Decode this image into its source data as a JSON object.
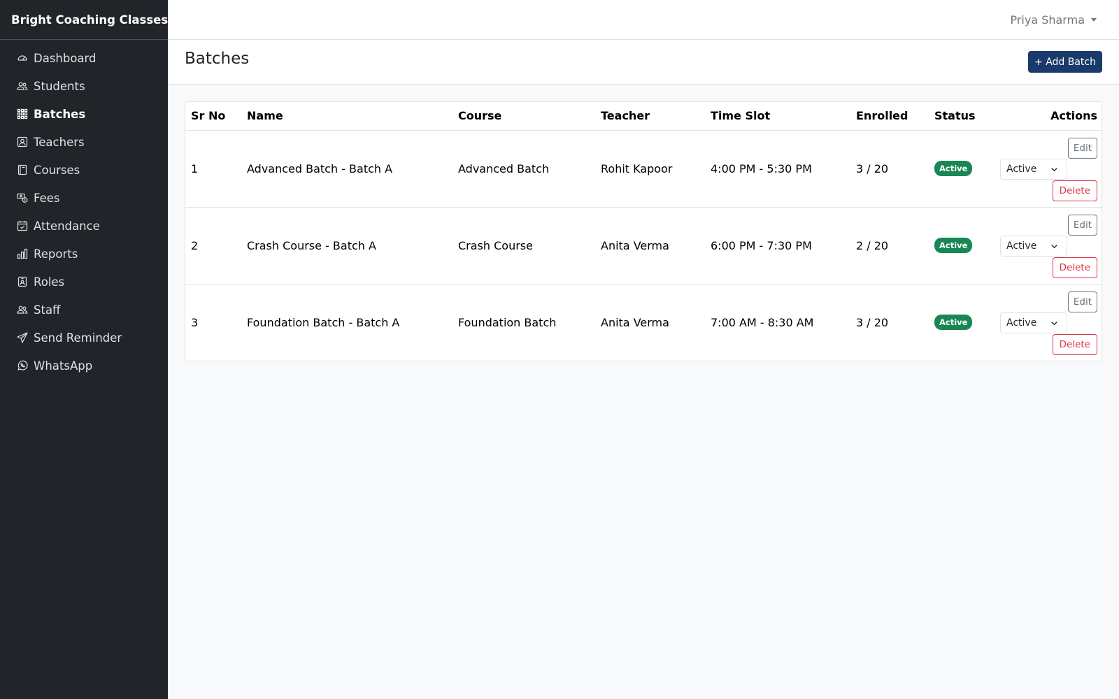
{
  "app": {
    "brand": "Bright Coaching Classes"
  },
  "sidebar": {
    "items": [
      {
        "label": "Dashboard",
        "icon": "speedometer-icon",
        "active": false
      },
      {
        "label": "Students",
        "icon": "people-icon",
        "active": false
      },
      {
        "label": "Batches",
        "icon": "grid-icon",
        "active": true
      },
      {
        "label": "Teachers",
        "icon": "person-badge-icon",
        "active": false
      },
      {
        "label": "Courses",
        "icon": "book-icon",
        "active": false
      },
      {
        "label": "Fees",
        "icon": "cash-coin-icon",
        "active": false
      },
      {
        "label": "Attendance",
        "icon": "calendar-check-icon",
        "active": false
      },
      {
        "label": "Reports",
        "icon": "bar-chart-icon",
        "active": false
      },
      {
        "label": "Roles",
        "icon": "id-badge-icon",
        "active": false
      },
      {
        "label": "Staff",
        "icon": "people-icon",
        "active": false
      },
      {
        "label": "Send Reminder",
        "icon": "send-icon",
        "active": false
      },
      {
        "label": "WhatsApp",
        "icon": "whatsapp-icon",
        "active": false
      }
    ]
  },
  "topbar": {
    "user_name": "Priya Sharma"
  },
  "page": {
    "title": "Batches",
    "add_button": "+ Add Batch"
  },
  "table": {
    "headers": {
      "sr": "Sr No",
      "name": "Name",
      "course": "Course",
      "teacher": "Teacher",
      "time": "Time Slot",
      "enrolled": "Enrolled",
      "status": "Status",
      "actions": "Actions"
    },
    "rows": [
      {
        "sr": "1",
        "name": "Advanced Batch - Batch A",
        "course": "Advanced Batch",
        "teacher": "Rohit Kapoor",
        "time": "4:00 PM - 5:30 PM",
        "enrolled": "3 / 20",
        "status": "Active",
        "select_value": "Active",
        "edit": "Edit",
        "delete": "Delete"
      },
      {
        "sr": "2",
        "name": "Crash Course - Batch A",
        "course": "Crash Course",
        "teacher": "Anita Verma",
        "time": "6:00 PM - 7:30 PM",
        "enrolled": "2 / 20",
        "status": "Active",
        "select_value": "Active",
        "edit": "Edit",
        "delete": "Delete"
      },
      {
        "sr": "3",
        "name": "Foundation Batch - Batch A",
        "course": "Foundation Batch",
        "teacher": "Anita Verma",
        "time": "7:00 AM - 8:30 AM",
        "enrolled": "3 / 20",
        "status": "Active",
        "select_value": "Active",
        "edit": "Edit",
        "delete": "Delete"
      }
    ]
  },
  "colors": {
    "sidebar_bg": "#212529",
    "primary": "#1a3a6b",
    "success": "#198754",
    "danger": "#dc3545",
    "secondary": "#6c757d"
  }
}
